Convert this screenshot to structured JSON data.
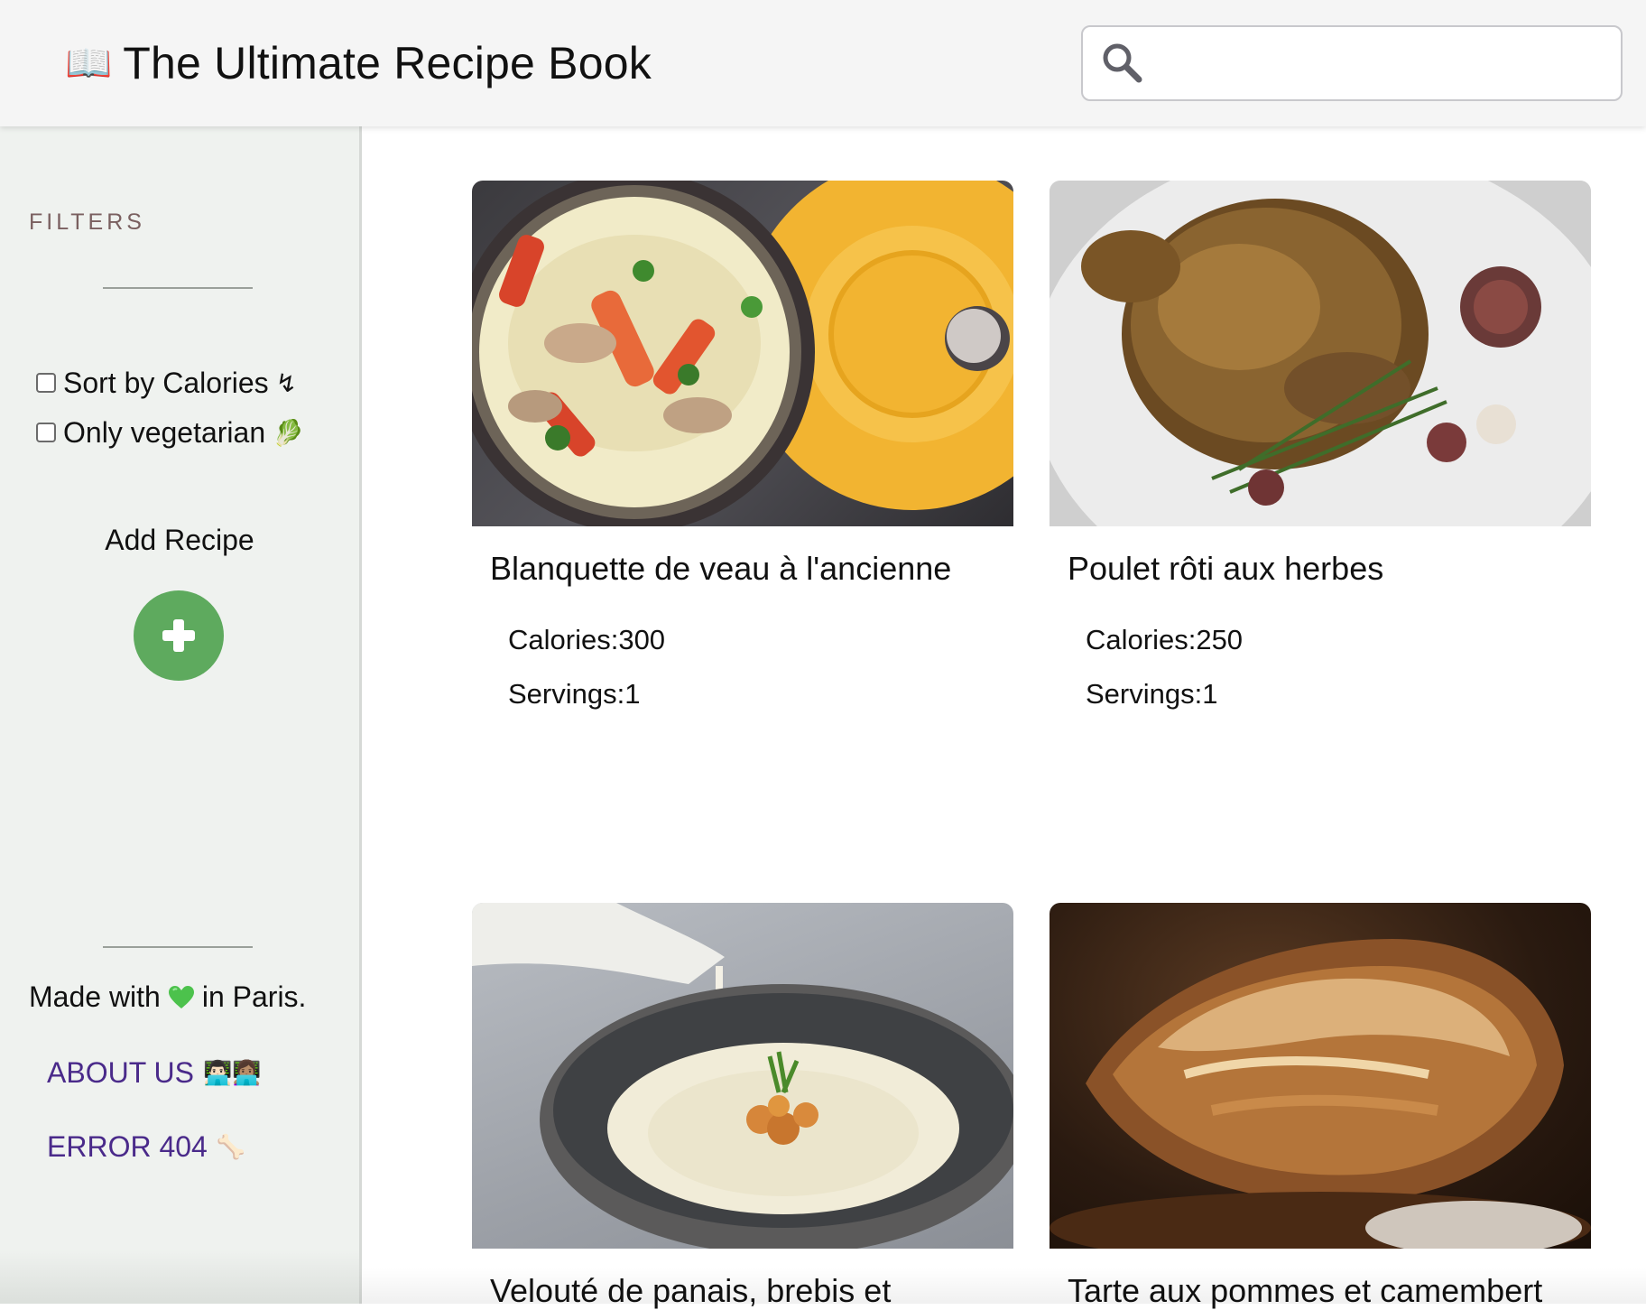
{
  "header": {
    "title": "The Ultimate Recipe Book",
    "book_icon": "📖",
    "search": {
      "value": "",
      "placeholder": ""
    }
  },
  "sidebar": {
    "filters_heading": "FILTERS",
    "filters": [
      {
        "label": "Sort by Calories",
        "emoji": "↯",
        "checked": false
      },
      {
        "label": "Only vegetarian",
        "emoji": "🥬",
        "checked": false
      }
    ],
    "add_recipe_label": "Add Recipe",
    "footer": {
      "made_with_prefix": "Made with",
      "made_with_suffix": "in Paris.",
      "links": [
        {
          "label": "ABOUT US",
          "emoji": "👨🏻‍💻👩🏽‍💻"
        },
        {
          "label": "ERROR 404",
          "emoji": "🦴"
        }
      ]
    }
  },
  "recipes": [
    {
      "title": "Blanquette de veau à l'ancienne",
      "calories_label": "Calories:",
      "calories": "300",
      "servings_label": "Servings:",
      "servings": "1"
    },
    {
      "title": "Poulet rôti aux herbes",
      "calories_label": "Calories:",
      "calories": "250",
      "servings_label": "Servings:",
      "servings": "1"
    },
    {
      "title": "Velouté de panais, brebis et"
    },
    {
      "title": "Tarte aux pommes et camembert"
    }
  ],
  "colors": {
    "header_bg": "#f5f5f5",
    "sidebar_bg": "#eff2ef",
    "add_button": "#5eaa5e",
    "link": "#4a2a8a",
    "filters_heading": "#7a6060",
    "heart": "#4cc24c"
  },
  "icons": {
    "search": "search-icon",
    "add": "plus-icon",
    "heart": "heart-icon"
  }
}
